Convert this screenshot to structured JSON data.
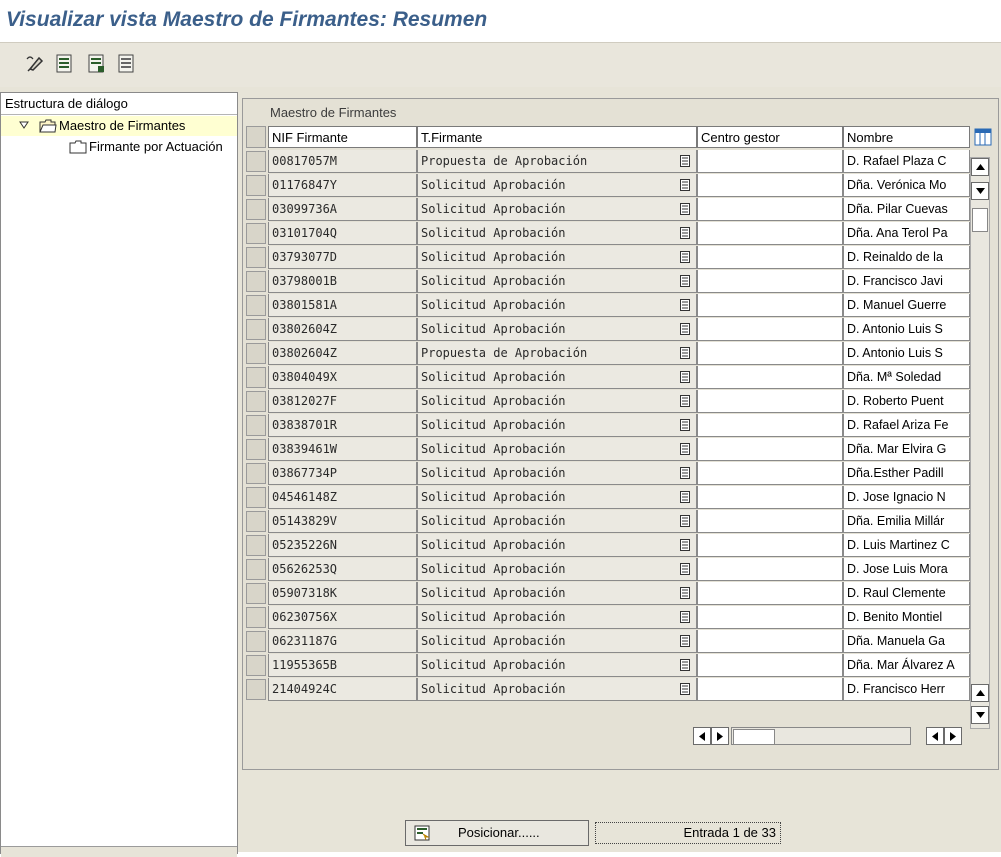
{
  "window": {
    "title": "Visualizar vista Maestro de Firmantes: Resumen"
  },
  "toolbar": {
    "icons": [
      "change-display-icon",
      "new-entries-icon",
      "copy-icon",
      "delete-icon"
    ]
  },
  "tree": {
    "header": "Estructura de diálogo",
    "items": [
      {
        "label": "Maestro de Firmantes",
        "expanded": true,
        "selected": true
      },
      {
        "label": "Firmante por Actuación"
      }
    ]
  },
  "table": {
    "caption": "Maestro de Firmantes",
    "columns": [
      "NIF Firmante",
      "T.Firmante",
      "Centro gestor",
      "Nombre"
    ],
    "rows": [
      {
        "nif": "00817057M",
        "tipo": "Propuesta de Aprobación",
        "centro": "",
        "nombre": "D. Rafael Plaza C"
      },
      {
        "nif": "01176847Y",
        "tipo": "Solicitud Aprobación",
        "centro": "",
        "nombre": "Dña. Verónica Mo"
      },
      {
        "nif": "03099736A",
        "tipo": "Solicitud Aprobación",
        "centro": "",
        "nombre": "Dña. Pilar Cuevas"
      },
      {
        "nif": "03101704Q",
        "tipo": "Solicitud Aprobación",
        "centro": "",
        "nombre": "Dña. Ana Terol Pa"
      },
      {
        "nif": "03793077D",
        "tipo": "Solicitud Aprobación",
        "centro": "",
        "nombre": "D. Reinaldo de la"
      },
      {
        "nif": "03798001B",
        "tipo": "Solicitud Aprobación",
        "centro": "",
        "nombre": "D. Francisco Javi"
      },
      {
        "nif": "03801581A",
        "tipo": "Solicitud Aprobación",
        "centro": "",
        "nombre": "D. Manuel Guerre"
      },
      {
        "nif": "03802604Z",
        "tipo": "Solicitud Aprobación",
        "centro": "",
        "nombre": "D. Antonio Luis S"
      },
      {
        "nif": "03802604Z",
        "tipo": "Propuesta de Aprobación",
        "centro": "",
        "nombre": "D. Antonio Luis S"
      },
      {
        "nif": "03804049X",
        "tipo": "Solicitud Aprobación",
        "centro": "",
        "nombre": "Dña. Mª Soledad"
      },
      {
        "nif": "03812027F",
        "tipo": "Solicitud Aprobación",
        "centro": "",
        "nombre": "D. Roberto Puent"
      },
      {
        "nif": "03838701R",
        "tipo": "Solicitud Aprobación",
        "centro": "",
        "nombre": "D. Rafael Ariza Fe"
      },
      {
        "nif": "03839461W",
        "tipo": "Solicitud Aprobación",
        "centro": "",
        "nombre": "Dña. Mar Elvira G"
      },
      {
        "nif": "03867734P",
        "tipo": "Solicitud Aprobación",
        "centro": "",
        "nombre": "Dña.Esther Padill"
      },
      {
        "nif": "04546148Z",
        "tipo": "Solicitud Aprobación",
        "centro": "",
        "nombre": "D. Jose Ignacio N"
      },
      {
        "nif": "05143829V",
        "tipo": "Solicitud Aprobación",
        "centro": "",
        "nombre": "Dña. Emilia Millár"
      },
      {
        "nif": "05235226N",
        "tipo": "Solicitud Aprobación",
        "centro": "",
        "nombre": "D. Luis Martinez C"
      },
      {
        "nif": "05626253Q",
        "tipo": "Solicitud Aprobación",
        "centro": "",
        "nombre": "D. Jose Luis Mora"
      },
      {
        "nif": "05907318K",
        "tipo": "Solicitud Aprobación",
        "centro": "",
        "nombre": "D. Raul Clemente"
      },
      {
        "nif": "06230756X",
        "tipo": "Solicitud Aprobación",
        "centro": "",
        "nombre": "D. Benito Montiel"
      },
      {
        "nif": "06231187G",
        "tipo": "Solicitud Aprobación",
        "centro": "",
        "nombre": "Dña. Manuela Ga"
      },
      {
        "nif": "11955365B",
        "tipo": "Solicitud Aprobación",
        "centro": "",
        "nombre": "Dña. Mar Álvarez A"
      },
      {
        "nif": "21404924C",
        "tipo": "Solicitud Aprobación",
        "centro": "",
        "nombre": "D. Francisco Herr"
      }
    ]
  },
  "bottom": {
    "position_button": "Posicionar......",
    "entry_info": "Entrada 1 de 33"
  },
  "colors": {
    "title": "#3b5f8a",
    "background": "#e7e4d8",
    "selected": "#ffffd2"
  }
}
